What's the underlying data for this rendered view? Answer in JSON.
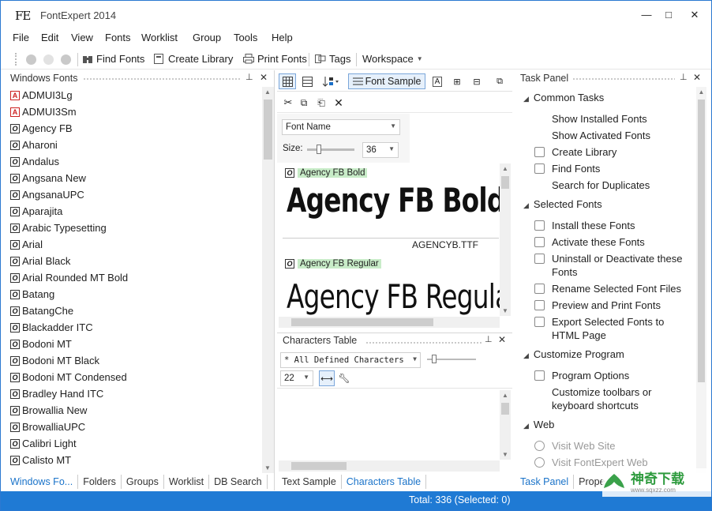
{
  "window": {
    "logo": "FE",
    "title": "FontExpert 2014",
    "min": "—",
    "max": "□",
    "close": "✕"
  },
  "menu": [
    "File",
    "Edit",
    "View",
    "Fonts",
    "Worklist",
    "Group",
    "Tools",
    "Help"
  ],
  "toolbar": {
    "find": "Find Fonts",
    "create": "Create Library",
    "print": "Print Fonts",
    "tags": "Tags",
    "workspace": "Workspace"
  },
  "left": {
    "title": "Windows Fonts",
    "fonts": [
      {
        "name": "ADMUI3Lg",
        "type": "A"
      },
      {
        "name": "ADMUI3Sm",
        "type": "A"
      },
      {
        "name": "Agency FB",
        "type": "O"
      },
      {
        "name": "Aharoni",
        "type": "O"
      },
      {
        "name": "Andalus",
        "type": "O"
      },
      {
        "name": "Angsana New",
        "type": "O"
      },
      {
        "name": "AngsanaUPC",
        "type": "O"
      },
      {
        "name": "Aparajita",
        "type": "O"
      },
      {
        "name": "Arabic Typesetting",
        "type": "O"
      },
      {
        "name": "Arial",
        "type": "O"
      },
      {
        "name": "Arial Black",
        "type": "O"
      },
      {
        "name": "Arial Rounded MT Bold",
        "type": "O"
      },
      {
        "name": "Batang",
        "type": "O"
      },
      {
        "name": "BatangChe",
        "type": "O"
      },
      {
        "name": "Blackadder ITC",
        "type": "O"
      },
      {
        "name": "Bodoni MT",
        "type": "O"
      },
      {
        "name": "Bodoni MT Black",
        "type": "O"
      },
      {
        "name": "Bodoni MT Condensed",
        "type": "O"
      },
      {
        "name": "Bradley Hand ITC",
        "type": "O"
      },
      {
        "name": "Browallia New",
        "type": "O"
      },
      {
        "name": "BrowalliaUPC",
        "type": "O"
      },
      {
        "name": "Calibri Light",
        "type": "O"
      },
      {
        "name": "Calisto MT",
        "type": "O"
      }
    ],
    "tabs": [
      "Windows Fo...",
      "Folders",
      "Groups",
      "Worklist",
      "DB Search"
    ]
  },
  "middle": {
    "font_sample_btn": "Font Sample",
    "sort_field": "Font Name",
    "size_label": "Size:",
    "size_value": "36",
    "samples": [
      {
        "label": "Agency FB Bold",
        "text": "Agency FB Bold",
        "file": "AGENCYB.TTF"
      },
      {
        "label": "Agency FB Regular",
        "text": "Agency FB Regular"
      }
    ],
    "chars_title": "Characters Table",
    "chars_filter": "* All Defined Characters",
    "chars_size": "22",
    "tabs": [
      "Text Sample",
      "Characters Table"
    ]
  },
  "task": {
    "title": "Task Panel",
    "sections": [
      {
        "title": "Common Tasks",
        "items": [
          "Show Installed Fonts",
          "Show Activated Fonts",
          "Create Library",
          "Find Fonts",
          "Search for Duplicates"
        ]
      },
      {
        "title": "Selected Fonts",
        "items": [
          "Install these Fonts",
          "Activate these Fonts",
          "Uninstall or Deactivate these Fonts",
          "Rename Selected Font Files",
          "Preview and Print Fonts",
          "Export Selected Fonts to HTML Page"
        ]
      },
      {
        "title": "Customize Program",
        "items": [
          "Program Options",
          "Customize toolbars or keyboard shortcuts"
        ]
      },
      {
        "title": "Web",
        "items": [
          "Visit Web Site",
          "Visit FontExpert Web"
        ]
      }
    ],
    "tabs": [
      "Task Panel",
      "Prope..."
    ]
  },
  "status": "Total: 336 (Selected: 0)",
  "watermark": {
    "cn": "神奇下载",
    "url": "www.sqxzz.com"
  }
}
